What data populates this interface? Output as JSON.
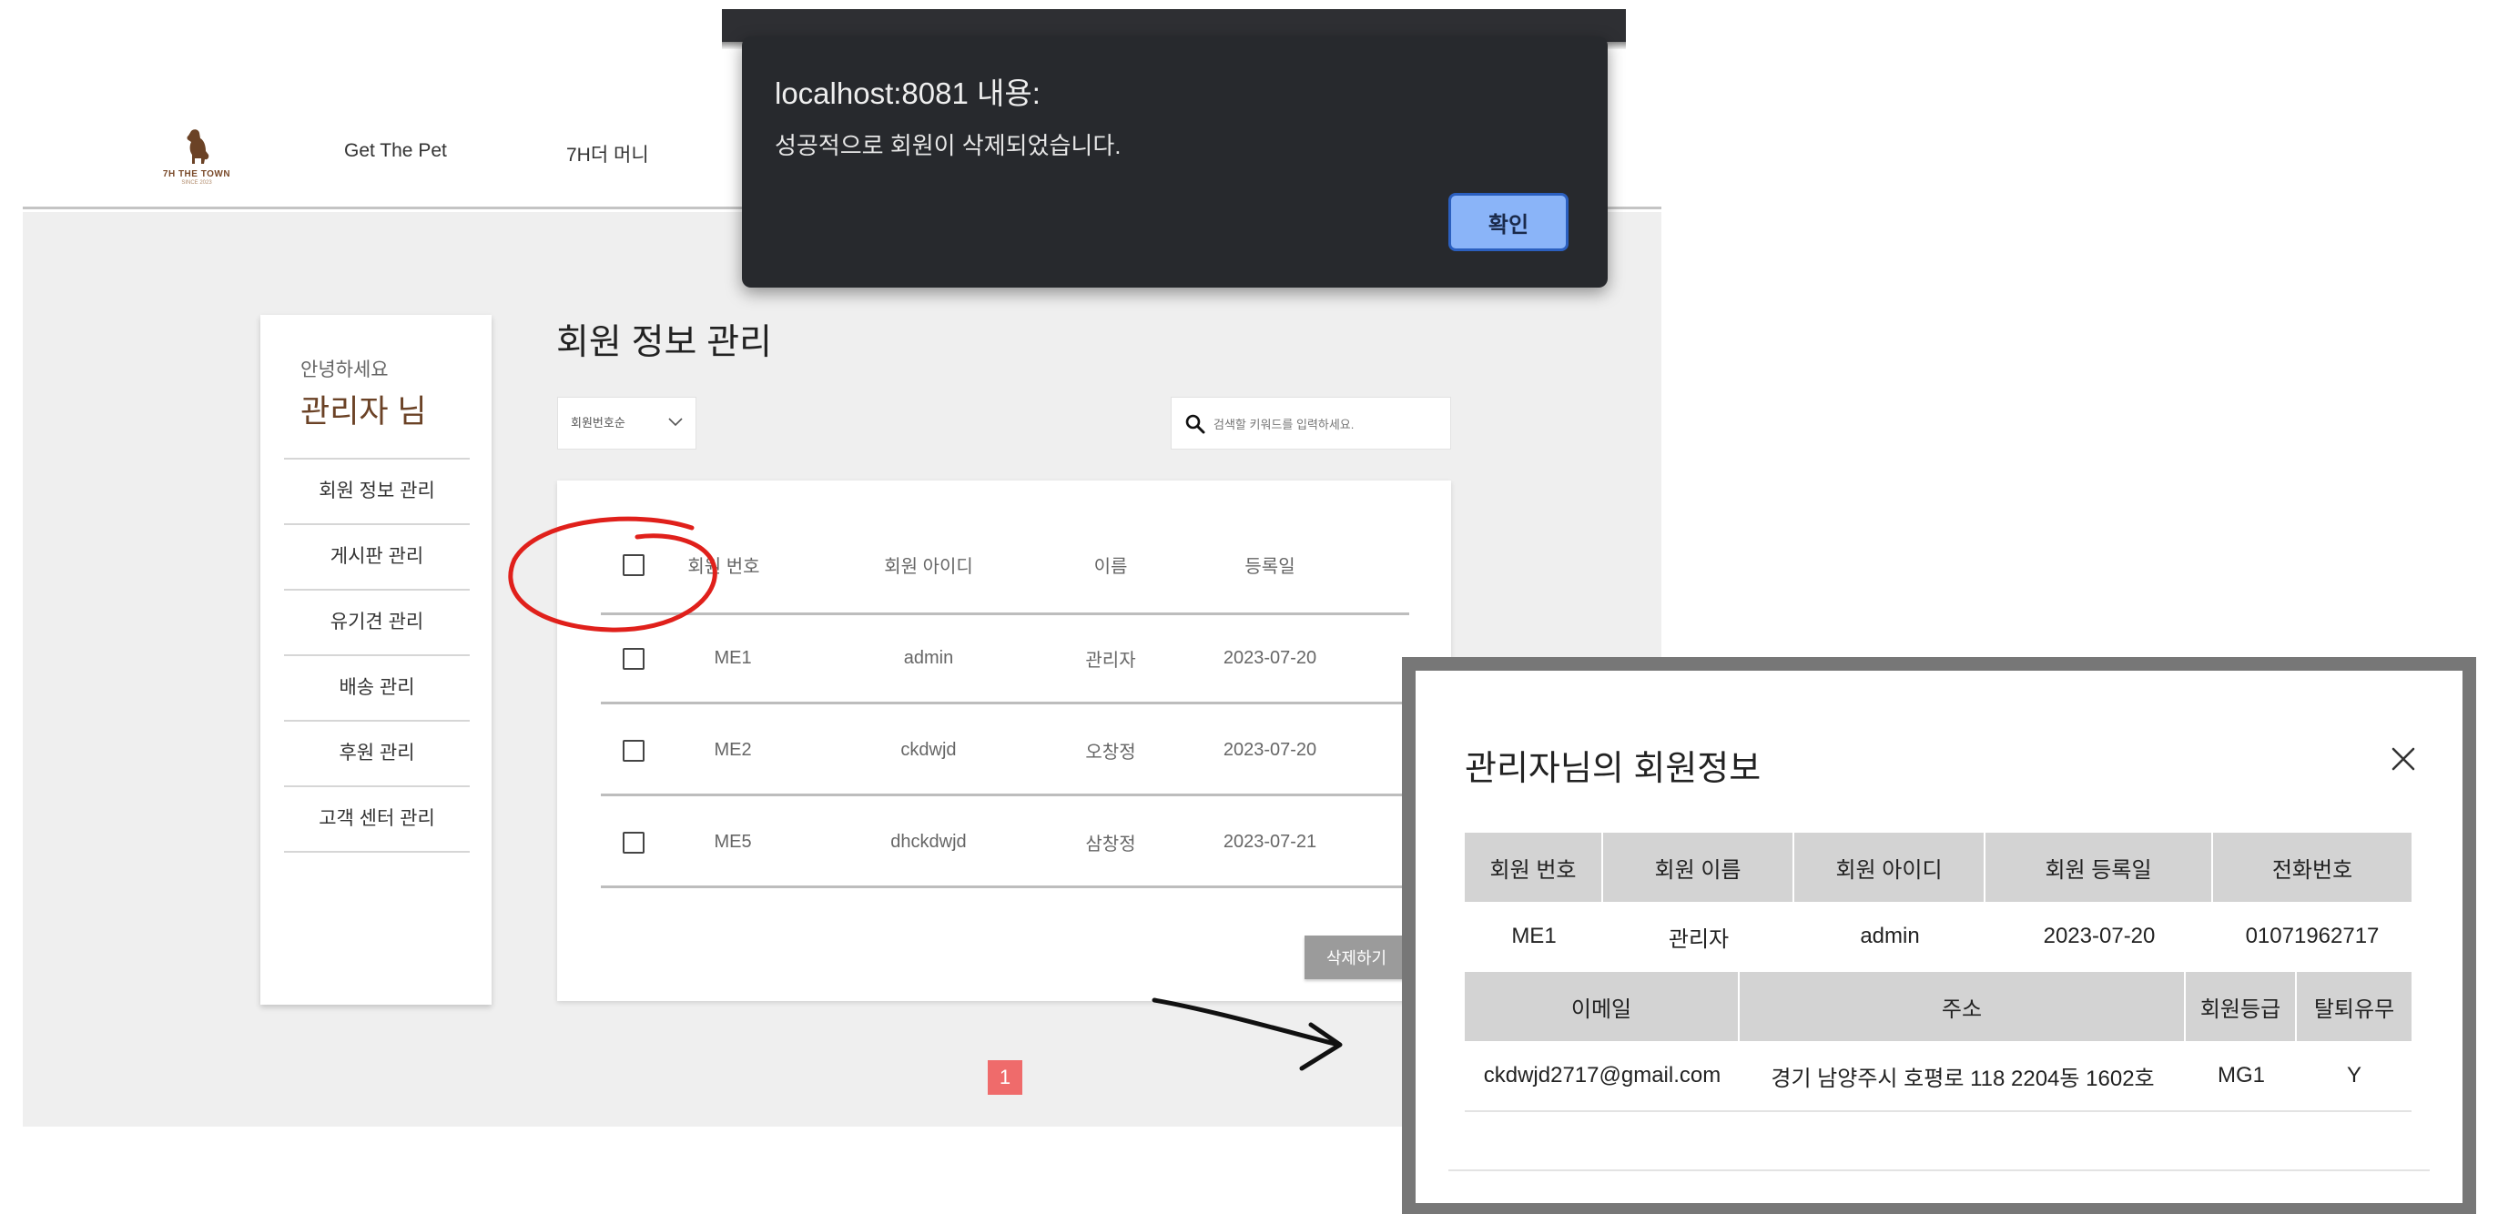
{
  "nav": {
    "logo_text": "7H THE TOWN",
    "logo_sub": "SINCE 2023",
    "items": [
      "Get The Pet",
      "7H더 머니"
    ]
  },
  "sidebar": {
    "greeting": "안녕하세요",
    "name": "관리자 님",
    "items": [
      "회원 정보 관리",
      "게시판 관리",
      "유기견 관리",
      "배송 관리",
      "후원 관리",
      "고객 센터 관리"
    ]
  },
  "main": {
    "title": "회원 정보 관리",
    "sort_value": "회원번호순",
    "search_placeholder": "검색할 키워드를 입력하세요.",
    "columns": [
      "회원 번호",
      "회원 아이디",
      "이름",
      "등록일"
    ],
    "rows": [
      {
        "no": "ME1",
        "id": "admin",
        "name": "관리자",
        "date": "2023-07-20"
      },
      {
        "no": "ME2",
        "id": "ckdwjd",
        "name": "오창정",
        "date": "2023-07-20"
      },
      {
        "no": "ME5",
        "id": "dhckdwjd",
        "name": "삼창정",
        "date": "2023-07-21"
      }
    ],
    "delete_label": "삭제하기",
    "page": "1"
  },
  "alert": {
    "title": "localhost:8081 내용:",
    "message": "성공적으로 회원이 삭제되었습니다.",
    "ok_label": "확인"
  },
  "modal": {
    "title": "관리자님의 회원정보",
    "head1": [
      "회원 번호",
      "회원 이름",
      "회원 아이디",
      "회원 등록일",
      "전화번호"
    ],
    "row1": [
      "ME1",
      "관리자",
      "admin",
      "2023-07-20",
      "01071962717"
    ],
    "head2": [
      "이메일",
      "주소",
      "회원등급",
      "탈퇴유무"
    ],
    "row2": [
      "ckdwjd2717@gmail.com",
      "경기 남양주시 호평로 118 2204동 1602호",
      "MG1",
      "Y"
    ]
  },
  "colors": {
    "brand_brown": "#6b4226",
    "page_badge": "#ef6b6b",
    "annotation_red": "#e0201b",
    "alert_button": "#8ab4f8"
  }
}
